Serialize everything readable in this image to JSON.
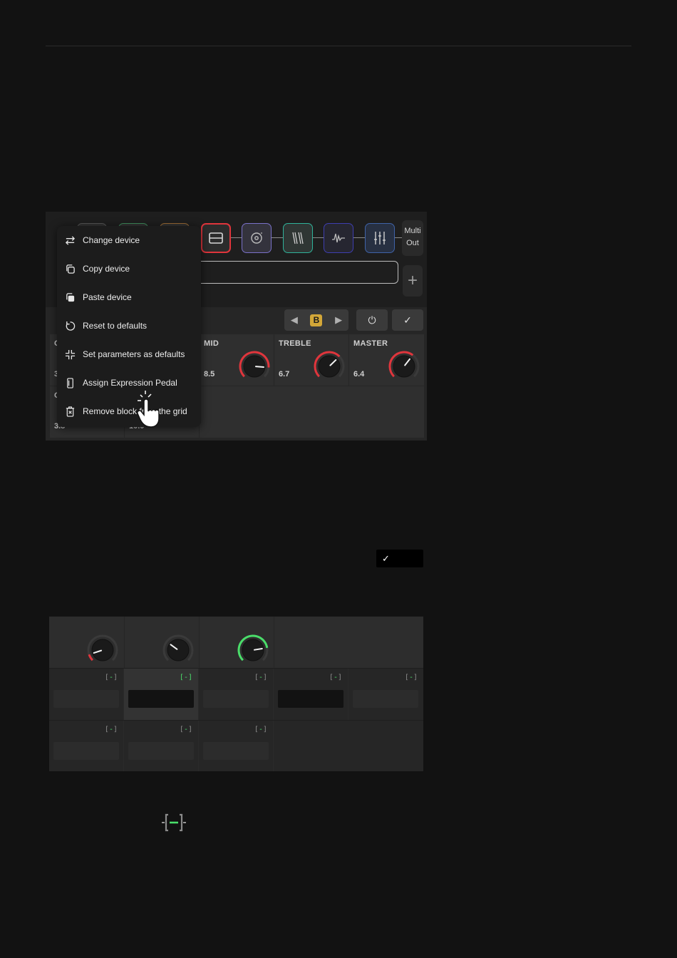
{
  "chain": {
    "multi_out_line1": "Multi",
    "multi_out_line2": "Out",
    "add_label": "+"
  },
  "toolbar": {
    "ab_prev": "◀",
    "ab_letter": "B",
    "ab_next": "▶",
    "power_label": "⏻",
    "confirm_label": "✓"
  },
  "params": [
    {
      "label": "MID",
      "value": "8.5",
      "level": 0.85,
      "color": "#e0353c"
    },
    {
      "label": "TREBLE",
      "value": "6.7",
      "level": 0.67,
      "color": "#e0353c"
    },
    {
      "label": "MASTER",
      "value": "6.4",
      "level": 0.64,
      "color": "#e0353c"
    }
  ],
  "hidden_values": {
    "row1_first": "3",
    "row1_first_label": "C",
    "row2_first_label": "C",
    "row2_first_value": "3.8",
    "row2_second_value": "10.0"
  },
  "context_menu": {
    "items": [
      {
        "label": "Change device",
        "icon": "swap-icon"
      },
      {
        "label": "Copy device",
        "icon": "copy-icon"
      },
      {
        "label": "Paste device",
        "icon": "paste-icon"
      },
      {
        "label": "Reset to defaults",
        "icon": "reset-icon"
      },
      {
        "label": "Set parameters as defaults",
        "icon": "collapse-icon"
      },
      {
        "label": "Assign Expression Pedal",
        "icon": "pedal-icon"
      },
      {
        "label": "Remove block from the grid",
        "icon": "trash-icon"
      }
    ]
  },
  "confirm_chip": {
    "label": "✓"
  },
  "assign_panel": {
    "knob_levels": [
      0.1,
      0.3,
      0.8
    ],
    "knob_colors": [
      "#e0353c",
      "#3a3a3a",
      "#4ade6a"
    ],
    "marker": "[-]"
  },
  "colors": {
    "accent_red": "#e0353c",
    "accent_green": "#4ade6a",
    "accent_gold": "#d3a738"
  }
}
